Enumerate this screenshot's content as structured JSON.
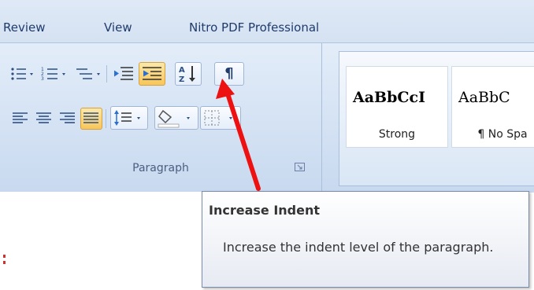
{
  "tabs": [
    "Review",
    "View",
    "Nitro PDF Professional"
  ],
  "paragraph_group": {
    "label": "Paragraph",
    "buttons": {
      "bullets": "bullets-list-icon",
      "numbering": "numbered-list-icon",
      "multilevel": "multilevel-list-icon",
      "decrease_indent": "decrease-indent-icon",
      "increase_indent": "increase-indent-icon",
      "sort": "sort-az-icon",
      "show_hide": "¶",
      "align_left": "align-left-icon",
      "center": "align-center-icon",
      "align_right": "align-right-icon",
      "justify": "justify-icon",
      "line_spacing": "line-spacing-icon",
      "shading": "shading-icon",
      "borders": "borders-icon"
    }
  },
  "styles": [
    {
      "sample": "AaBbCcI",
      "name": "Strong"
    },
    {
      "sample": "AaBbC",
      "name": "¶ No Spa"
    }
  ],
  "tooltip": {
    "title": "Increase Indent",
    "body": "Increase the indent level of the paragraph."
  },
  "colors": {
    "accent": "#ff0000",
    "active_button": "#f7c65a",
    "ribbon": "#d5e2f2"
  }
}
